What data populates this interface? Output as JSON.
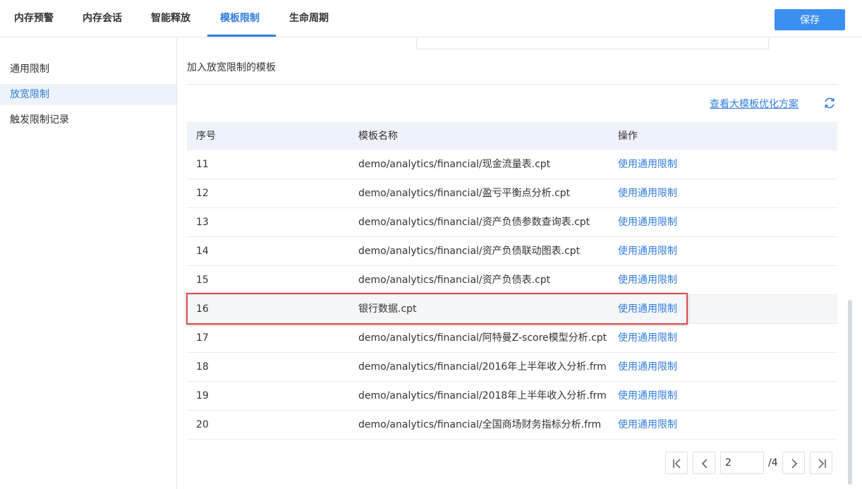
{
  "tabs": [
    {
      "label": "内存预警"
    },
    {
      "label": "内存会话"
    },
    {
      "label": "智能释放"
    },
    {
      "label": "模板限制",
      "active": true
    },
    {
      "label": "生命周期"
    }
  ],
  "save_label": "保存",
  "sidebar": {
    "items": [
      {
        "label": "通用限制"
      },
      {
        "label": "放宽限制",
        "active": true
      },
      {
        "label": "触发限制记录"
      }
    ]
  },
  "main": {
    "section_title": "加入放宽限制的模板",
    "optimize_link": "查看大模板优化方案",
    "refresh_icon": "refresh-icon"
  },
  "table": {
    "headers": [
      "序号",
      "模板名称",
      "操作"
    ],
    "rows": [
      {
        "index": "11",
        "name": "demo/analytics/financial/现金流量表.cpt",
        "action": "使用通用限制"
      },
      {
        "index": "12",
        "name": "demo/analytics/financial/盈亏平衡点分析.cpt",
        "action": "使用通用限制"
      },
      {
        "index": "13",
        "name": "demo/analytics/financial/资产负债参数查询表.cpt",
        "action": "使用通用限制"
      },
      {
        "index": "14",
        "name": "demo/analytics/financial/资产负债联动图表.cpt",
        "action": "使用通用限制"
      },
      {
        "index": "15",
        "name": "demo/analytics/financial/资产负债表.cpt",
        "action": "使用通用限制"
      },
      {
        "index": "16",
        "name": "银行数据.cpt",
        "action": "使用通用限制",
        "highlighted": true
      },
      {
        "index": "17",
        "name": "demo/analytics/financial/阿特曼Z-score模型分析.cpt",
        "action": "使用通用限制"
      },
      {
        "index": "18",
        "name": "demo/analytics/financial/2016年上半年收入分析.frm",
        "action": "使用通用限制"
      },
      {
        "index": "19",
        "name": "demo/analytics/financial/2018年上半年收入分析.frm",
        "action": "使用通用限制"
      },
      {
        "index": "20",
        "name": "demo/analytics/financial/全国商场财务指标分析.frm",
        "action": "使用通用限制"
      }
    ]
  },
  "pagination": {
    "current_page": "2",
    "total": "/4"
  },
  "colors": {
    "accent": "#2f7dde",
    "highlight_border": "#e24a4a"
  }
}
